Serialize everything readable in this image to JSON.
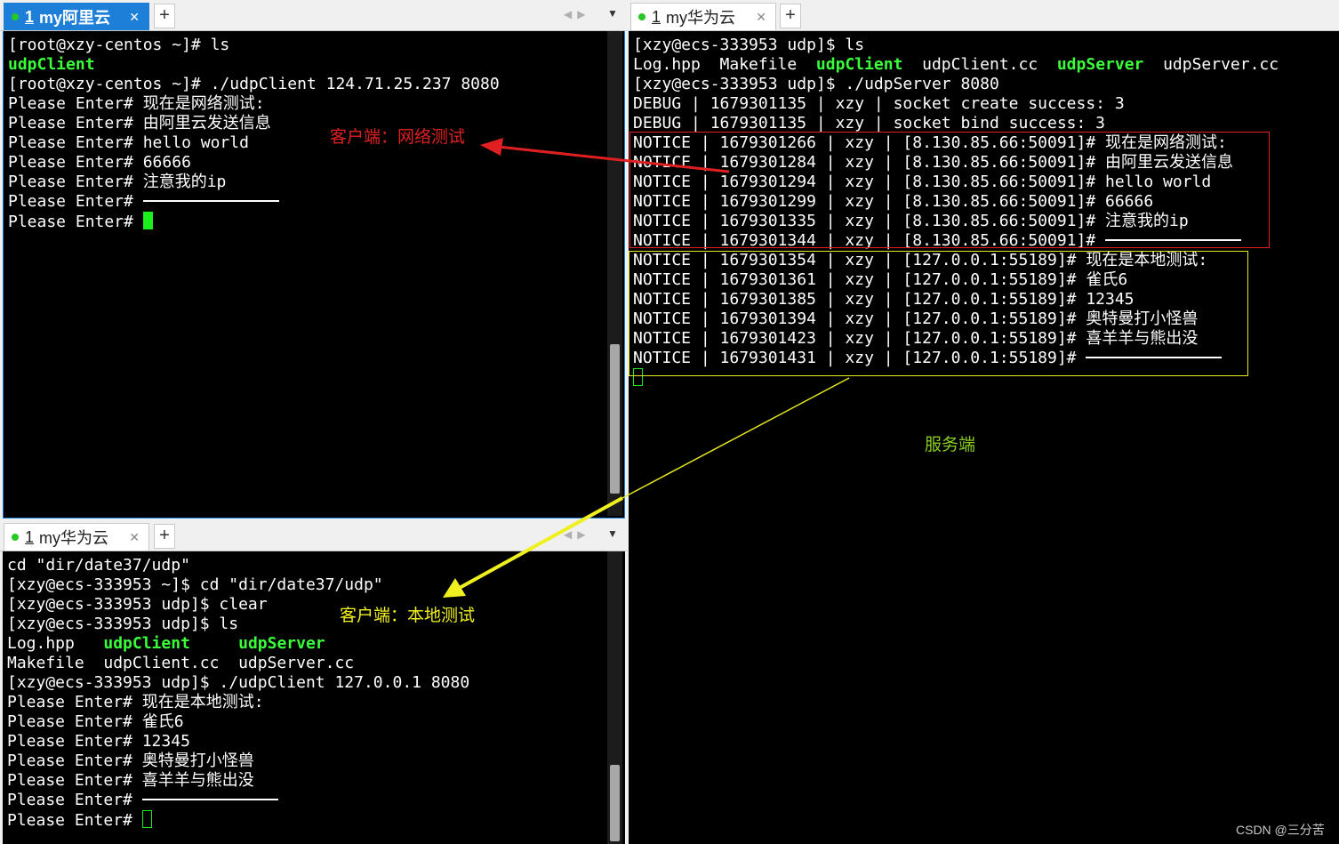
{
  "top_left": {
    "tab": {
      "number": "1",
      "label": "my阿里云",
      "close": "✕"
    },
    "add": "+",
    "nav": "◀▶",
    "menu": "▼",
    "lines": [
      {
        "text": "[root@xzy-centos ~]# ls"
      },
      {
        "text": "udpClient",
        "green": true
      },
      {
        "text": "[root@xzy-centos ~]# ./udpClient 124.71.25.237 8080"
      },
      {
        "text": "Please Enter# 现在是网络测试:"
      },
      {
        "text": "Please Enter# 由阿里云发送信息"
      },
      {
        "text": "Please Enter# hello world"
      },
      {
        "text": "Please Enter# 66666"
      },
      {
        "text": "Please Enter# 注意我的ip"
      },
      {
        "text": "Please Enter# ",
        "rule": true
      },
      {
        "text": "Please Enter# ",
        "cursor": "solid"
      }
    ]
  },
  "right": {
    "tab": {
      "number": "1",
      "label": "my华为云",
      "close": "✕"
    },
    "add": "+",
    "lines": [
      {
        "text": "[xzy@ecs-333953 udp]$ ls"
      },
      {
        "parts": [
          {
            "t": "Log.hpp  Makefile  "
          },
          {
            "t": "udpClient",
            "green": true
          },
          {
            "t": "  udpClient.cc  "
          },
          {
            "t": "udpServer",
            "green": true
          },
          {
            "t": "  udpServer.cc"
          }
        ]
      },
      {
        "text": "[xzy@ecs-333953 udp]$ ./udpServer 8080"
      },
      {
        "text": "DEBUG | 1679301135 | xzy | socket create success: 3"
      },
      {
        "text": "DEBUG | 1679301135 | xzy | socket bind success: 3"
      },
      {
        "text": "NOTICE | 1679301266 | xzy | [8.130.85.66:50091]# 现在是网络测试:"
      },
      {
        "text": "NOTICE | 1679301284 | xzy | [8.130.85.66:50091]# 由阿里云发送信息"
      },
      {
        "text": "NOTICE | 1679301294 | xzy | [8.130.85.66:50091]# hello world"
      },
      {
        "text": "NOTICE | 1679301299 | xzy | [8.130.85.66:50091]# 66666"
      },
      {
        "text": "NOTICE | 1679301335 | xzy | [8.130.85.66:50091]# 注意我的ip"
      },
      {
        "text": "NOTICE | 1679301344 | xzy | [8.130.85.66:50091]# ",
        "rule": true
      },
      {
        "text": "NOTICE | 1679301354 | xzy | [127.0.0.1:55189]# 现在是本地测试:"
      },
      {
        "text": "NOTICE | 1679301361 | xzy | [127.0.0.1:55189]# 雀氏6"
      },
      {
        "text": "NOTICE | 1679301385 | xzy | [127.0.0.1:55189]# 12345"
      },
      {
        "text": "NOTICE | 1679301394 | xzy | [127.0.0.1:55189]# 奥特曼打小怪兽"
      },
      {
        "text": "NOTICE | 1679301423 | xzy | [127.0.0.1:55189]# 喜羊羊与熊出没"
      },
      {
        "text": "NOTICE | 1679301431 | xzy | [127.0.0.1:55189]# ",
        "rule": true
      },
      {
        "text": "",
        "cursor": "hollow"
      }
    ]
  },
  "bottom_left": {
    "tab": {
      "number": "1",
      "label": "my华为云",
      "close": "✕"
    },
    "add": "+",
    "nav": "◀▶",
    "menu": "▼",
    "lines": [
      {
        "text": "cd \"dir/date37/udp\""
      },
      {
        "text": "[xzy@ecs-333953 ~]$ cd \"dir/date37/udp\""
      },
      {
        "text": "[xzy@ecs-333953 udp]$ clear"
      },
      {
        "text": "[xzy@ecs-333953 udp]$ ls"
      },
      {
        "parts": [
          {
            "t": "Log.hpp   "
          },
          {
            "t": "udpClient",
            "green": true
          },
          {
            "t": "     "
          },
          {
            "t": "udpServer",
            "green": true
          }
        ]
      },
      {
        "text": "Makefile  udpClient.cc  udpServer.cc"
      },
      {
        "text": "[xzy@ecs-333953 udp]$ ./udpClient 127.0.0.1 8080"
      },
      {
        "text": "Please Enter# 现在是本地测试:"
      },
      {
        "text": "Please Enter# 雀氏6"
      },
      {
        "text": "Please Enter# 12345"
      },
      {
        "text": "Please Enter# 奥特曼打小怪兽"
      },
      {
        "text": "Please Enter# 喜羊羊与熊出没"
      },
      {
        "text": "Please Enter# ",
        "rule": true
      },
      {
        "text": "Please Enter# ",
        "cursor": "hollow"
      }
    ]
  },
  "annotations": {
    "client_network": {
      "text": "客户端：网络测试",
      "color": "#e02020"
    },
    "client_local": {
      "text": "客户端：本地测试",
      "color": "#f0f020"
    },
    "server": {
      "text": "服务端",
      "color": "#88cc22"
    }
  },
  "colors": {
    "terminal_bg": "#000000",
    "prompt_green": "#3aff3a",
    "tab_active": "#1e7fd8"
  },
  "watermark": "CSDN @三分苦"
}
